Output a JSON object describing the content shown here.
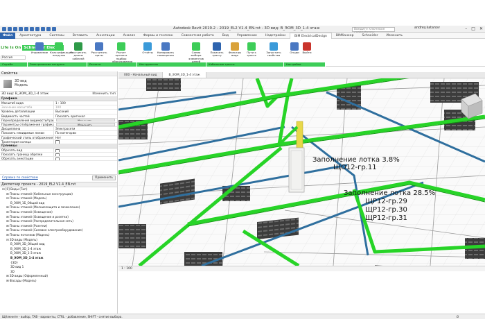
{
  "titlebar": {
    "title": "Autodesk Revit 2019.2 - 2019_EL2 V1.4_EN.rvt - 3D вид: В_ЭОМ_3D_1-4 этаж",
    "search_placeholder": "Введите ключевое слово/фразу",
    "user": "andrey.katanov",
    "controls": [
      "–",
      "□",
      "✕"
    ]
  },
  "tabs": [
    "Файл",
    "Архитектура",
    "Системы",
    "Вставить",
    "Аннотации",
    "Анализ",
    "Формы и генплан",
    "Совместная работа",
    "Вид",
    "Управление",
    "Надстройки",
    "BIM ElectricalDesign",
    "BIMбанкер",
    "Schneider",
    "Изменить"
  ],
  "active_tab": "BIM ElectricalDesign",
  "ribbon": {
    "logo_lio": "Life Is On",
    "logo_se": "Schneider Electric",
    "dropdown_value": "Россия",
    "buttons": [
      "Управление",
      "Классификация нагрузок",
      "Рассчитать длины кабелей",
      "Рассчитать щиты",
      "Расчет щитов и подбор оборудования",
      "Отчёты",
      "Копировать помещения",
      "Схема выбора элементов цепей",
      "Показать трассу",
      "Фильтры вида",
      "Пути к трассе",
      "Запустить свойства",
      "Опции",
      "Выйти"
    ],
    "panels": [
      "Служба",
      "Электрические нагрузки",
      "Расчеты",
      "Инструменты",
      "Кабельные трассы",
      "Настройки"
    ]
  },
  "properties": {
    "header": "Свойства",
    "type_name": "3D вид",
    "type_sub": "Модель",
    "view_selector": "3D вид: В_ЭОМ_3D_1-4 этаж",
    "edit_type": "Изменить тип",
    "groups": [
      {
        "name": "Графика",
        "rows": [
          {
            "k": "Масштаб вида",
            "v": "1 : 100",
            "kind": "text"
          },
          {
            "k": "Значение масштаба",
            "v": "100",
            "kind": "dim"
          },
          {
            "k": "Уровень детализации",
            "v": "Высокий",
            "kind": "text"
          },
          {
            "k": "Видимость частей",
            "v": "Показать оригинал",
            "kind": "text"
          },
          {
            "k": "Переопределения видимости/граф...",
            "v": "Изменить...",
            "kind": "btn"
          },
          {
            "k": "Параметры отображения графики",
            "v": "Изменить...",
            "kind": "btn"
          },
          {
            "k": "Дисциплина",
            "v": "Электросети",
            "kind": "text"
          },
          {
            "k": "Показать невидимые линии",
            "v": "По категории",
            "kind": "text"
          },
          {
            "k": "Графический стиль отображения р...",
            "v": "Нет",
            "kind": "text"
          },
          {
            "k": "Траектория солнца",
            "v": "",
            "kind": "cb"
          }
        ]
      },
      {
        "name": "Границы",
        "rows": [
          {
            "k": "Обрезать вид",
            "v": "",
            "kind": "cb"
          },
          {
            "k": "Показать границу обрезки",
            "v": "",
            "kind": "cb"
          },
          {
            "k": "Обрезать аннотации",
            "v": "",
            "kind": "cb"
          }
        ]
      }
    ],
    "help_link": "Справка по свойствам",
    "apply": "Применить"
  },
  "browser": {
    "header": "Диспетчер проекта - 2019_EL2 V1.4_EN.rvt",
    "items": [
      {
        "d": 0,
        "t": "⊟ [0] Виды (Тип)"
      },
      {
        "d": 1,
        "t": "⊞ Планы этажей (Кабельные конструкции)"
      },
      {
        "d": 1,
        "t": "⊟ Планы этажей (Модель)"
      },
      {
        "d": 2,
        "t": "В_ЭОМ_1Б_Общий вид"
      },
      {
        "d": 1,
        "t": "⊞ Планы этажей (Молниезащита и заземление)"
      },
      {
        "d": 1,
        "t": "⊞ Планы этажей (Освещение)"
      },
      {
        "d": 1,
        "t": "⊞ Планы этажей (Освещение и розетки)"
      },
      {
        "d": 1,
        "t": "⊞ Планы этажей (Распределительная сеть)"
      },
      {
        "d": 1,
        "t": "⊞ Планы этажей (Розетки)"
      },
      {
        "d": 1,
        "t": "⊞ Планы этажей (Силовое электрооборудование)"
      },
      {
        "d": 1,
        "t": "⊞ Планы потолков (Модель)"
      },
      {
        "d": 1,
        "t": "⊟ 3D виды (Модель)"
      },
      {
        "d": 2,
        "t": "В_ЭОМ_3D_Общий вид"
      },
      {
        "d": 2,
        "t": "В_ЭОМ_3D_1-4 этаж"
      },
      {
        "d": 2,
        "t": "В_ЭОМ_3D_1-3 этаж"
      },
      {
        "d": 2,
        "t": "В_ЭОМ_3D_1-4 этаж",
        "sel": true
      },
      {
        "d": 2,
        "t": "{3D}"
      },
      {
        "d": 2,
        "t": "3D вид 1"
      },
      {
        "d": 2,
        "t": "3D"
      },
      {
        "d": 1,
        "t": "⊞ 3D виды (Оформленный)"
      },
      {
        "d": 1,
        "t": "⊞ Фасады (Модель)"
      }
    ]
  },
  "view_tabs": [
    "000 - Начальный вид",
    "В_ЭОМ_3D_1-4 этаж"
  ],
  "active_view_tab": "В_ЭОМ_3D_1-4 этаж",
  "view_scale": "1 : 100",
  "status_text": "Щёлкните - выбор, TAB - варианты, CTRL - добавление, SHIFT - снятие выбора.",
  "status_zoom": ":0",
  "annotations": [
    {
      "line1": "Заполнение лотка 3.8%",
      "lines": [
        "ЩО12-гр.11"
      ]
    },
    {
      "line1": "Заполнение лотка 28.5%",
      "lines": [
        "ЩР12-гр.29",
        "ЩР12-гр.30",
        "ЩР12-гр.31"
      ]
    }
  ],
  "colors": {
    "accent": "#2e64ae",
    "schneider_green": "#3dcd58",
    "tray_green": "#22cc22",
    "pipe_blue": "#2f6f9e",
    "panel_yellow": "#e8d84a"
  }
}
